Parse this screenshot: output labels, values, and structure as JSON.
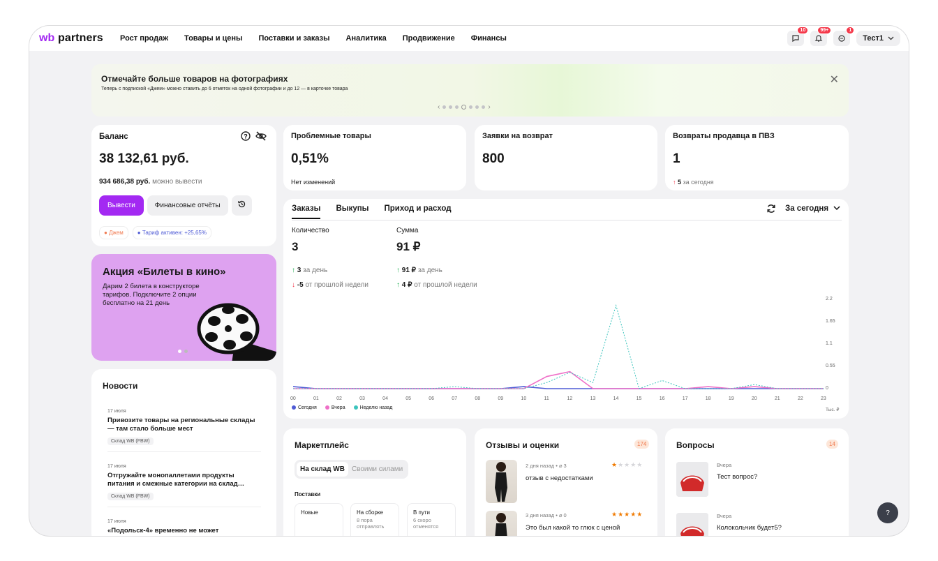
{
  "header": {
    "logo_wb": "wb",
    "logo_partners": "partners",
    "nav": [
      "Рост продаж",
      "Товары и цены",
      "Поставки и заказы",
      "Аналитика",
      "Продвижение",
      "Финансы"
    ],
    "badges": {
      "chat": "10",
      "bell": "99+",
      "messages": "1"
    },
    "user": "Тест1"
  },
  "banner": {
    "title": "Отмечайте больше товаров на фотографиях",
    "text": "Теперь с подпиской «Джем» можно ставить до 6 отметок на одной фотографии и до 12 — в карточке товара"
  },
  "balance": {
    "title": "Баланс",
    "amount": "38 132,61 руб.",
    "withdraw_amount": "934 686,38 руб.",
    "withdraw_note": "можно вывести",
    "btn_withdraw": "Вывести",
    "btn_reports": "Финансовые отчёты",
    "chip_jam": "Джем",
    "chip_tariff": "Тариф активен: +25,65%"
  },
  "promo": {
    "title": "Акция «Билеты в кино»",
    "text": "Дарим 2 билета в конструкторе тарифов. Подключите 2 опции бесплатно на 21 день"
  },
  "news": {
    "title": "Новости",
    "items": [
      {
        "date": "17 июля",
        "head": "Привозите товары на региональные склады — там стало больше мест",
        "tag": "Склад WB (FBW)"
      },
      {
        "date": "17 июля",
        "head": "Отгружайте монопаллетами продукты питания и смежные категории на склад…",
        "tag": "Склад WB (FBW)"
      },
      {
        "date": "17 июля",
        "head": "«Подольск-4» временно не может",
        "tag": ""
      }
    ]
  },
  "stats": [
    {
      "title": "Проблемные товары",
      "value": "0,51%",
      "note": "Нет изменений"
    },
    {
      "title": "Заявки на возврат",
      "value": "800",
      "note": ""
    },
    {
      "title": "Возвраты продавца в ПВЗ",
      "value": "1",
      "note_num": "5",
      "note": "за сегодня"
    }
  ],
  "orders": {
    "tabs": [
      "Заказы",
      "Выкупы",
      "Приход и расход"
    ],
    "period": "За сегодня",
    "qty_label": "Количество",
    "qty_value": "3",
    "qty_day_num": "3",
    "qty_day": "за день",
    "qty_week_num": "-5",
    "qty_week": "от прошлой недели",
    "sum_label": "Сумма",
    "sum_value": "91 ₽",
    "sum_day_num": "91 ₽",
    "sum_day": "за день",
    "sum_week_num": "4 ₽",
    "sum_week": "от прошлой недели",
    "unit": "Тыс. ₽"
  },
  "chart_data": {
    "type": "line",
    "x": [
      "00",
      "01",
      "02",
      "03",
      "04",
      "05",
      "06",
      "07",
      "08",
      "09",
      "10",
      "11",
      "12",
      "13",
      "14",
      "15",
      "16",
      "17",
      "18",
      "19",
      "20",
      "21",
      "22",
      "23"
    ],
    "yticks": [
      "2.2",
      "1.65",
      "1.1",
      "0.55",
      "0"
    ],
    "ylim": [
      0,
      2.2
    ],
    "series": [
      {
        "name": "Сегодня",
        "color": "#4f5bd5",
        "values": [
          0.05,
          0,
          0,
          0,
          0,
          0,
          0,
          0,
          0,
          0,
          0.05,
          0,
          0,
          0,
          0,
          0,
          0,
          0,
          0,
          0,
          0,
          0,
          0,
          0
        ]
      },
      {
        "name": "Вчера",
        "color": "#ef6fc8",
        "values": [
          0,
          0,
          0,
          0,
          0,
          0,
          0,
          0,
          0,
          0,
          0,
          0.3,
          0.42,
          0,
          0,
          0,
          0,
          0,
          0.05,
          0,
          0.05,
          0,
          0,
          0
        ]
      },
      {
        "name": "Неделю назад",
        "color": "#3cc4bd",
        "values": [
          0,
          0,
          0,
          0,
          0,
          0,
          0,
          0.05,
          0,
          0,
          0,
          0.15,
          0.4,
          0.15,
          2.05,
          0,
          0.2,
          0,
          0,
          0,
          0.1,
          0,
          0,
          0
        ]
      }
    ]
  },
  "marketplace": {
    "title": "Маркетплейс",
    "seg_a": "На склад WB",
    "seg_b": "Своими силами",
    "supplies": "Поставки",
    "cols": [
      {
        "title": "Новые",
        "sub": ""
      },
      {
        "title": "На сборке",
        "sub": "8 пора отправлять"
      },
      {
        "title": "В пути",
        "sub": "6 скоро отменятся"
      }
    ]
  },
  "reviews": {
    "title": "Отзывы и оценки",
    "count": "174",
    "items": [
      {
        "meta": "2 дня назад",
        "clips": "3",
        "text": "отзыв с недостатками",
        "stars": 1
      },
      {
        "meta": "3 дня назад",
        "clips": "0",
        "text": "Это был какой то глюк с ценой",
        "stars": 5
      }
    ]
  },
  "questions": {
    "title": "Вопросы",
    "count": "14",
    "items": [
      {
        "meta": "Вчера",
        "text": "Тест вопрос?"
      },
      {
        "meta": "Вчера",
        "text": "Колокольчик будет5?"
      }
    ]
  },
  "help": "?"
}
